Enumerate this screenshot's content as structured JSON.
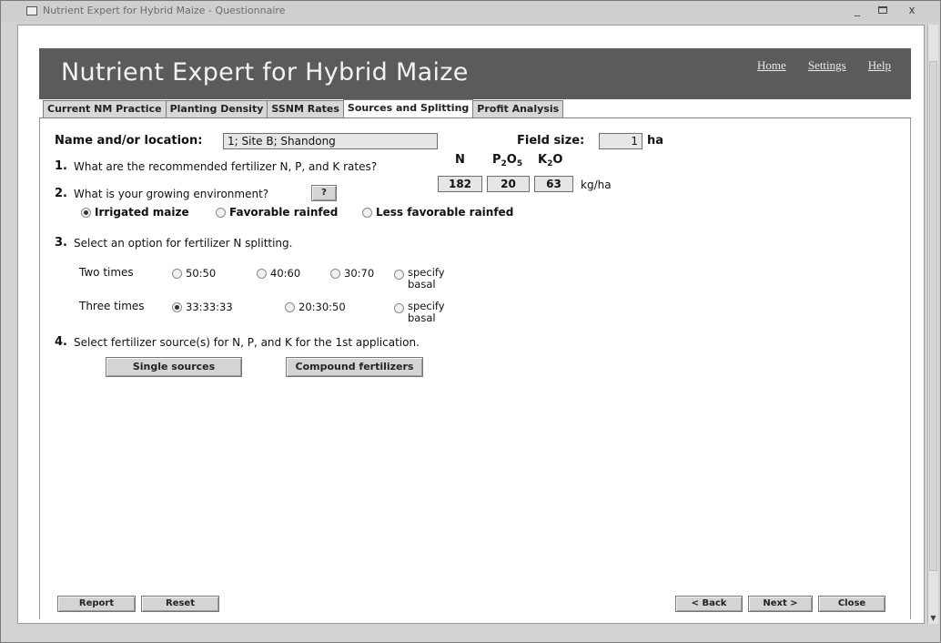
{
  "window": {
    "title": "Nutrient Expert for Hybrid Maize - Questionnaire",
    "minimize": "_",
    "close": "x"
  },
  "header": {
    "title": "Nutrient Expert for Hybrid Maize",
    "links": [
      "Home",
      "Settings",
      "Help"
    ]
  },
  "tabs": [
    {
      "label": "Current NM Practice"
    },
    {
      "label": "Planting Density"
    },
    {
      "label": "SSNM Rates"
    },
    {
      "label": "Sources and Splitting",
      "active": true
    },
    {
      "label": "Profit Analysis"
    }
  ],
  "form": {
    "location_label": "Name and/or location:",
    "location_value": "1; Site B; Shandong",
    "field_size_label": "Field size:",
    "field_size_value": "1",
    "field_size_unit": "ha",
    "q1": {
      "number": "1.",
      "text": "What are the recommended fertilizer N, P, and K rates?",
      "n_header": "N",
      "p_header_main": "P",
      "p_header_sub1": "2",
      "p_header_mid": "O",
      "p_header_sub2": "5",
      "k_header_main": "K",
      "k_header_sub": "2",
      "k_header_end": "O",
      "n_value": "182",
      "p_value": "20",
      "k_value": "63",
      "unit": "kg/ha"
    },
    "q2": {
      "number": "2.",
      "text": "What is your growing environment?",
      "help_button": "?",
      "options": [
        {
          "label": "Irrigated maize",
          "selected": true
        },
        {
          "label": "Favorable rainfed",
          "selected": false
        },
        {
          "label": "Less favorable rainfed",
          "selected": false
        }
      ]
    },
    "q3": {
      "number": "3.",
      "text": "Select an option for fertilizer N splitting.",
      "two_times_label": "Two times",
      "two_times_options": [
        {
          "label": "50:50",
          "selected": false
        },
        {
          "label": "40:60",
          "selected": false
        },
        {
          "label": "30:70",
          "selected": false
        },
        {
          "label": "specify",
          "label2": "basal",
          "selected": false
        }
      ],
      "three_times_label": "Three times",
      "three_times_options": [
        {
          "label": "33:33:33",
          "selected": true
        },
        {
          "label": "20:30:50",
          "selected": false
        },
        {
          "label": "specify",
          "label2": "basal",
          "selected": false
        }
      ]
    },
    "q4": {
      "number": "4.",
      "text": "Select fertilizer source(s) for N, P, and K for the 1st application.",
      "single_sources": "Single sources",
      "compound_fertilizers": "Compound fertilizers"
    }
  },
  "footer": {
    "report": "Report",
    "reset": "Reset",
    "back": "< Back",
    "next": "Next >",
    "close": "Close"
  }
}
